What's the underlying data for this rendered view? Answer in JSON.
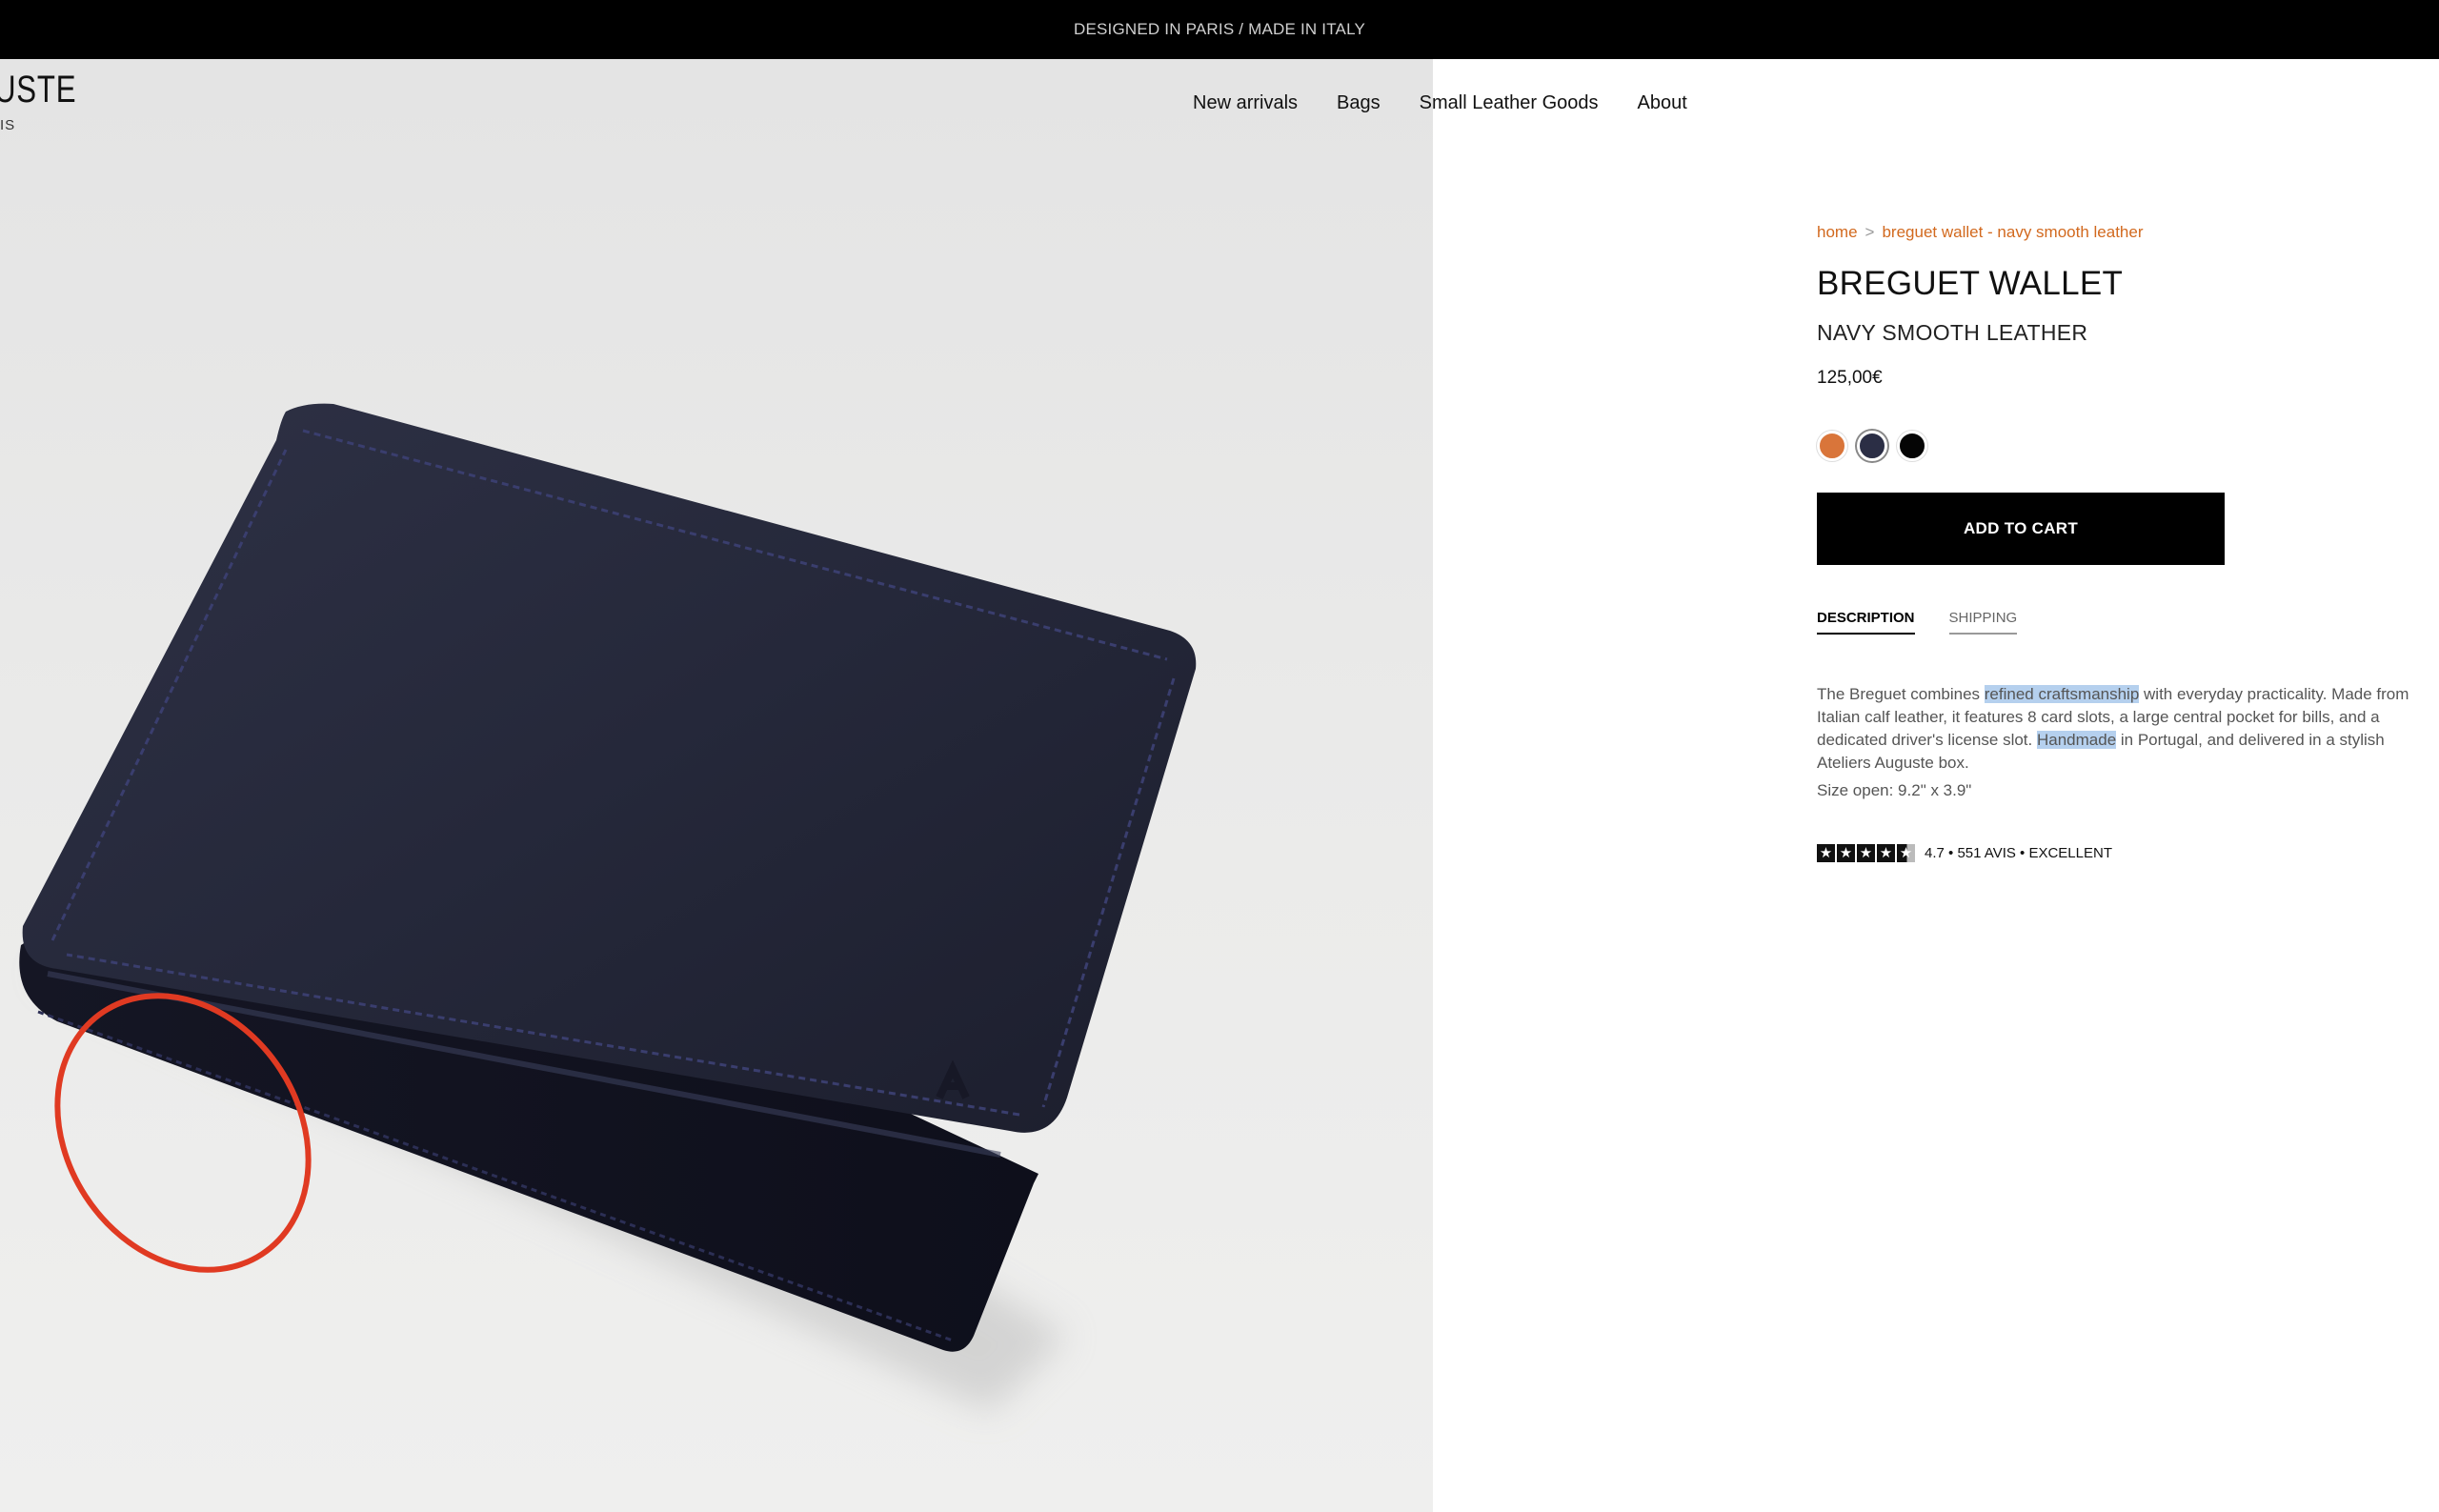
{
  "announcement": "DESIGNED IN PARIS / MADE IN ITALY",
  "logo": {
    "word": "USTE",
    "sub": "IS"
  },
  "nav": [
    "New arrivals",
    "Bags",
    "Small Leather Goods",
    "About"
  ],
  "breadcrumb": {
    "home": "home",
    "separator": ">",
    "current": "breguet wallet - navy smooth leather"
  },
  "product": {
    "title": "BREGUET WALLET",
    "subtitle": "NAVY SMOOTH LEATHER",
    "price": "125,00€",
    "swatches": [
      {
        "name": "orange",
        "color": "#d9753a",
        "selected": false
      },
      {
        "name": "navy",
        "color": "#2b2e45",
        "selected": true
      },
      {
        "name": "black",
        "color": "#050505",
        "selected": false
      }
    ],
    "add_to_cart": "ADD TO CART"
  },
  "tabs": [
    "DESCRIPTION",
    "SHIPPING"
  ],
  "description": {
    "p1": "The Breguet combines ",
    "h1": "refined craftsmanship",
    "p2": " with everyday practicality. Made from Italian calf leather, it features 8 card slots, a large central pocket for bills, and a dedicated driver's license slot. ",
    "h2": "Handmade",
    "p3": " in Portugal, and delivered in a stylish Ateliers Auguste box.",
    "size": "Size open: 9.2\" x 3.9\""
  },
  "rating": {
    "stars": 4.7,
    "text": "4.7 • 551 AVIS • EXCELLENT"
  },
  "colors": {
    "accent": "#d2691e",
    "annotation": "#e03a22",
    "wallet": "#23253a"
  }
}
